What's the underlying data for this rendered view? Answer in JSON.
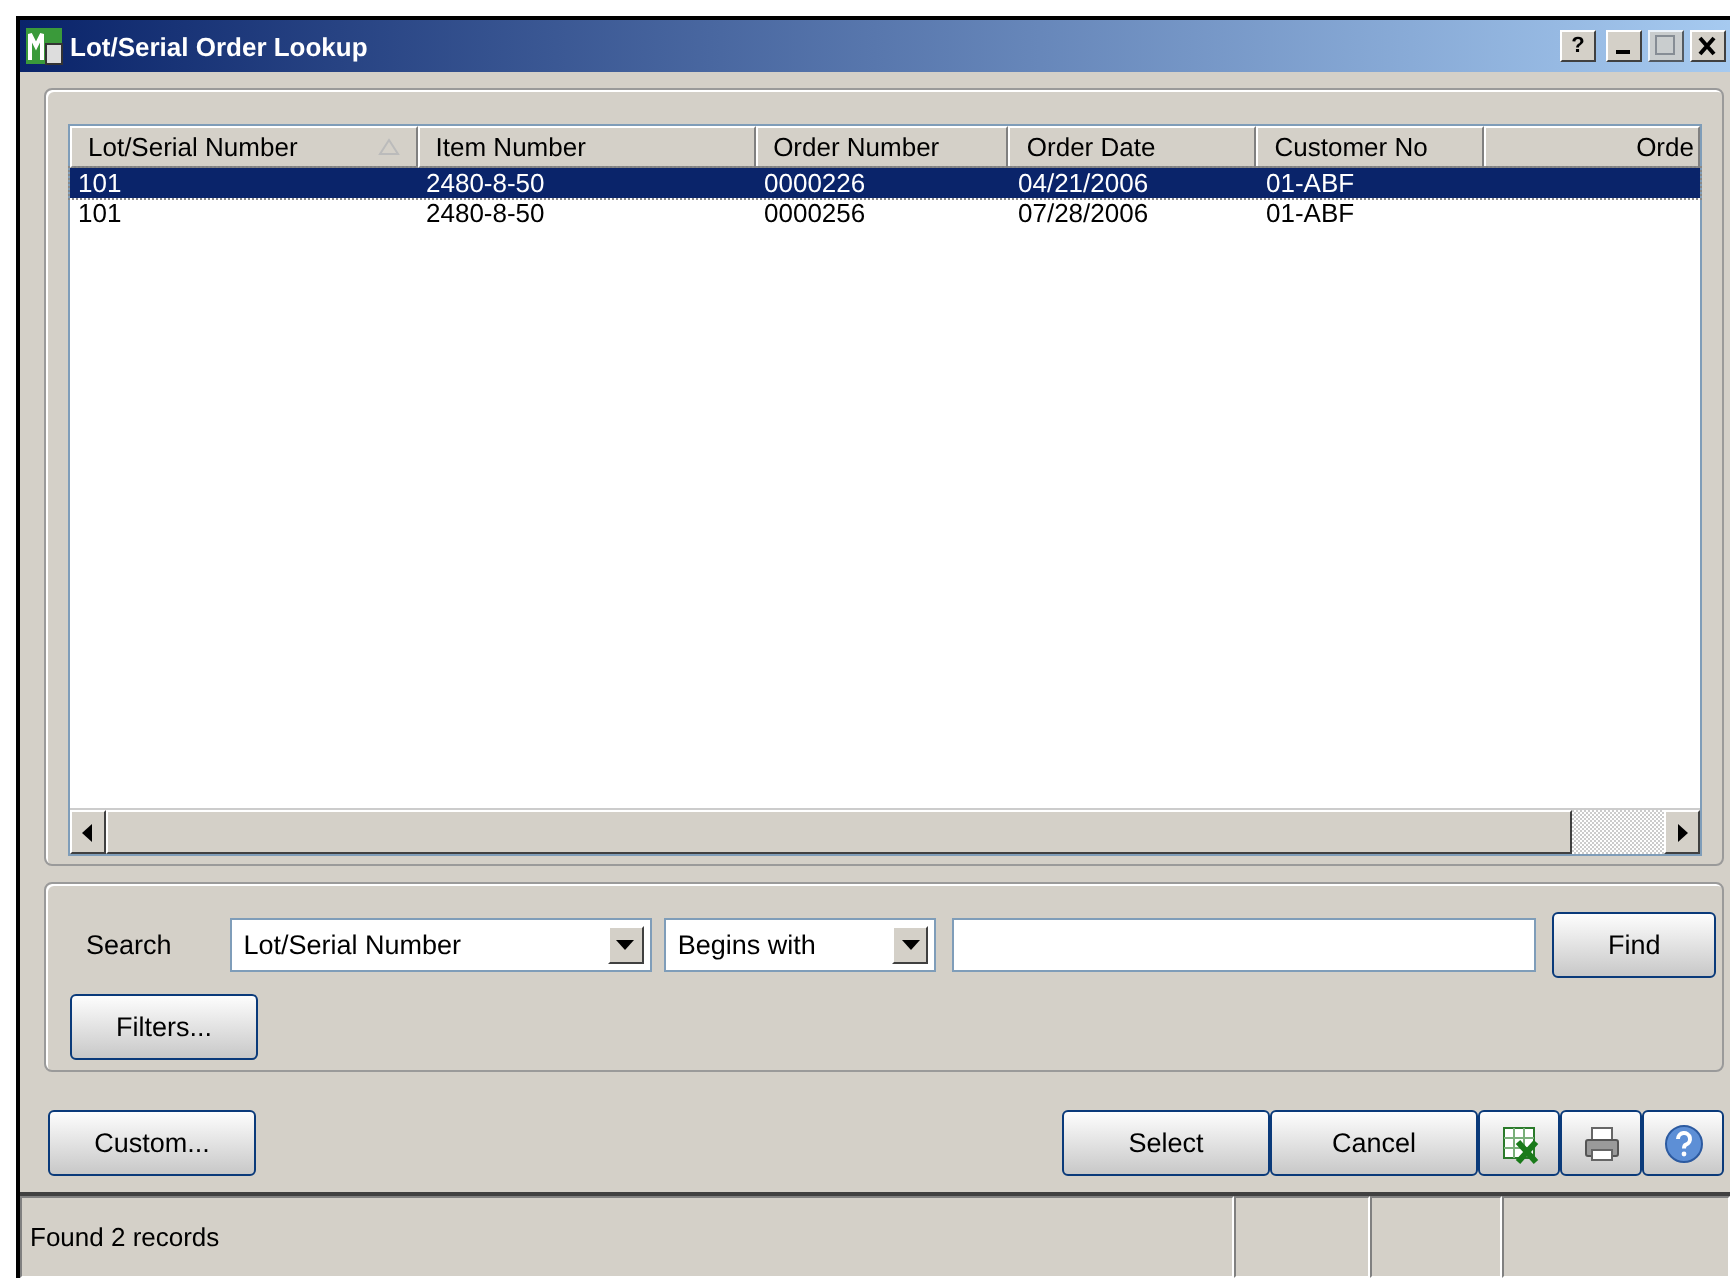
{
  "window": {
    "title": "Lot/Serial Order Lookup",
    "controls": [
      "?"
    ]
  },
  "table": {
    "columns": [
      {
        "label": "Lot/Serial Number",
        "sorted": true
      },
      {
        "label": "Item Number",
        "sorted": false
      },
      {
        "label": "Order Number",
        "sorted": false
      },
      {
        "label": "Order Date",
        "sorted": false
      },
      {
        "label": "Customer No",
        "sorted": false
      },
      {
        "label": "Orde",
        "sorted": false
      }
    ],
    "rows": [
      {
        "cells": [
          "101",
          "2480-8-50",
          "0000226",
          "04/21/2006",
          "01-ABF"
        ],
        "selected": true
      },
      {
        "cells": [
          "101",
          "2480-8-50",
          "0000256",
          "07/28/2006",
          "01-ABF"
        ],
        "selected": false
      }
    ]
  },
  "search": {
    "label": "Search",
    "field": "Lot/Serial Number",
    "operator": "Begins with",
    "find": {
      "label": "Find"
    },
    "filters": {
      "label": "Filters..."
    }
  },
  "buttons": [
    {
      "kind": "text",
      "label": "Custom..."
    },
    {
      "kind": "text",
      "label": "Select"
    },
    {
      "kind": "text",
      "label": "Cancel"
    },
    {
      "kind": "excel"
    },
    {
      "kind": "print"
    },
    {
      "kind": "help"
    }
  ],
  "status_bar": {
    "message": "Found 2 records"
  }
}
